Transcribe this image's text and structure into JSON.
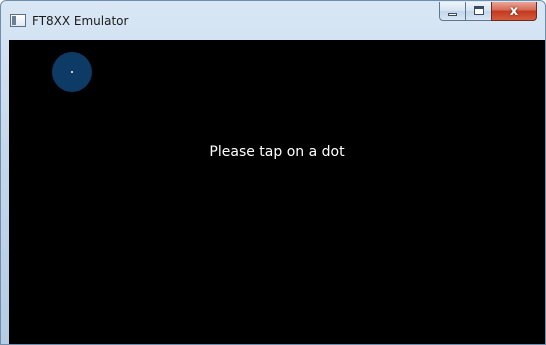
{
  "window": {
    "title": "FT8XX Emulator",
    "icon": "app-window-icon",
    "controls": {
      "minimize": "minimize-icon",
      "maximize": "maximize-icon",
      "close": "close-icon",
      "close_glyph": "x"
    }
  },
  "screen": {
    "background": "#000000",
    "prompt": "Please tap on a dot",
    "dot_color": "#0e3a66",
    "dot_center_color": "#ffffff"
  }
}
